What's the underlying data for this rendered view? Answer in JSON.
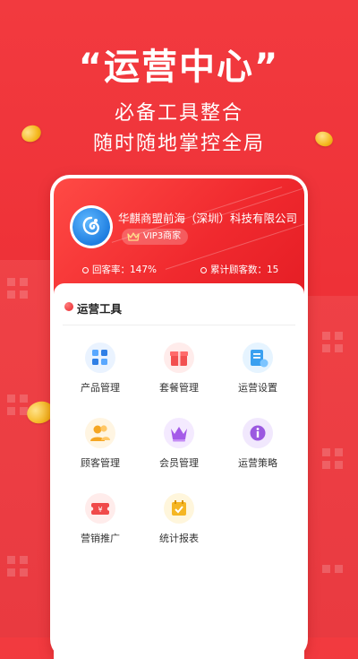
{
  "hero": {
    "title": "“运营中心”",
    "subtitle_line1": "必备工具整合",
    "subtitle_line2": "随时随地掌控全局"
  },
  "merchant": {
    "company_name": "华麒商盟前海（深圳）科技有限公司",
    "vip_label": "VIP3商家",
    "stats": [
      {
        "label": "回客率：147%"
      },
      {
        "label": "累计顾客数：15"
      }
    ]
  },
  "tools": {
    "title": "运营工具",
    "items": [
      {
        "label": "产品管理",
        "icon": "product-grid-icon",
        "color": "#3a8ef0"
      },
      {
        "label": "套餐管理",
        "icon": "gift-box-icon",
        "color": "#f04a4a"
      },
      {
        "label": "运营设置",
        "icon": "settings-card-icon",
        "color": "#3aa0f0"
      },
      {
        "label": "顾客管理",
        "icon": "customers-icon",
        "color": "#f5a623"
      },
      {
        "label": "会员管理",
        "icon": "crown-icon",
        "color": "#a45be8"
      },
      {
        "label": "运营策略",
        "icon": "strategy-info-icon",
        "color": "#9b59e0"
      },
      {
        "label": "营销推广",
        "icon": "coupon-icon",
        "color": "#f04a4a"
      },
      {
        "label": "统计报表",
        "icon": "calendar-check-icon",
        "color": "#f5b623"
      }
    ]
  },
  "colors": {
    "brand_red": "#ee3137",
    "white": "#ffffff"
  }
}
